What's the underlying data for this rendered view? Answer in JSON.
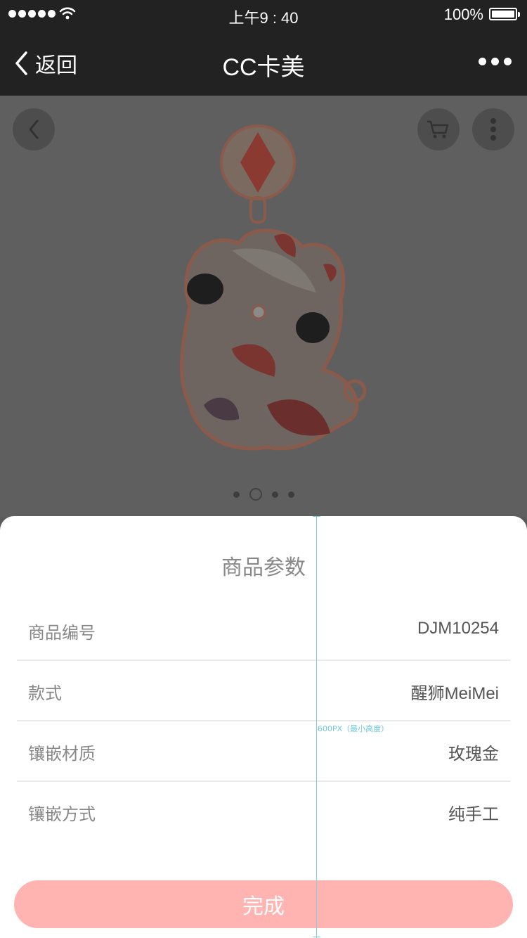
{
  "status_bar": {
    "time": "上午9 : 40",
    "battery": "100%"
  },
  "nav": {
    "back_label": "返回",
    "title": "CC卡美"
  },
  "gallery": {
    "slide_count": 4,
    "active_slide": 2
  },
  "sheet": {
    "title": "商品参数",
    "params": [
      {
        "label": "商品编号",
        "value": "DJM10254"
      },
      {
        "label": "款式",
        "value": "醒狮MeiMei"
      },
      {
        "label": "镶嵌材质",
        "value": "玫瑰金"
      },
      {
        "label": "镶嵌方式",
        "value": "纯手工"
      }
    ],
    "done_label": "完成"
  },
  "annotation": {
    "height_note": "600PX（最小高度）"
  },
  "colors": {
    "bar_bg": "#222222",
    "overlay": "#5f5f5f",
    "done_button": "#ffb4b1",
    "guide": "#7fd3e0"
  }
}
